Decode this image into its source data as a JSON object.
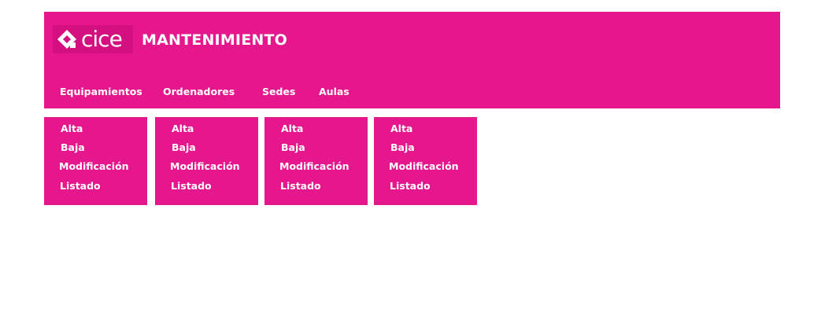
{
  "colors": {
    "brand_pink": "#e6178c",
    "logo_bg": "#d40f7f",
    "text": "#ffffff"
  },
  "header": {
    "logo_text": "cice",
    "logo_icon": "cice-logo-icon",
    "title": "MANTENIMIENTO"
  },
  "nav": {
    "items": [
      {
        "label": "Equipamientos"
      },
      {
        "label": "Ordenadores"
      },
      {
        "label": "Sedes"
      },
      {
        "label": "Aulas"
      }
    ]
  },
  "submenus": [
    {
      "items": [
        "Alta",
        "Baja",
        "Modificación",
        "Listado"
      ]
    },
    {
      "items": [
        "Alta",
        "Baja",
        "Modificación",
        "Listado"
      ]
    },
    {
      "items": [
        "Alta",
        "Baja",
        "Modificación",
        "Listado"
      ]
    },
    {
      "items": [
        "Alta",
        "Baja",
        "Modificación",
        "Listado"
      ]
    }
  ]
}
